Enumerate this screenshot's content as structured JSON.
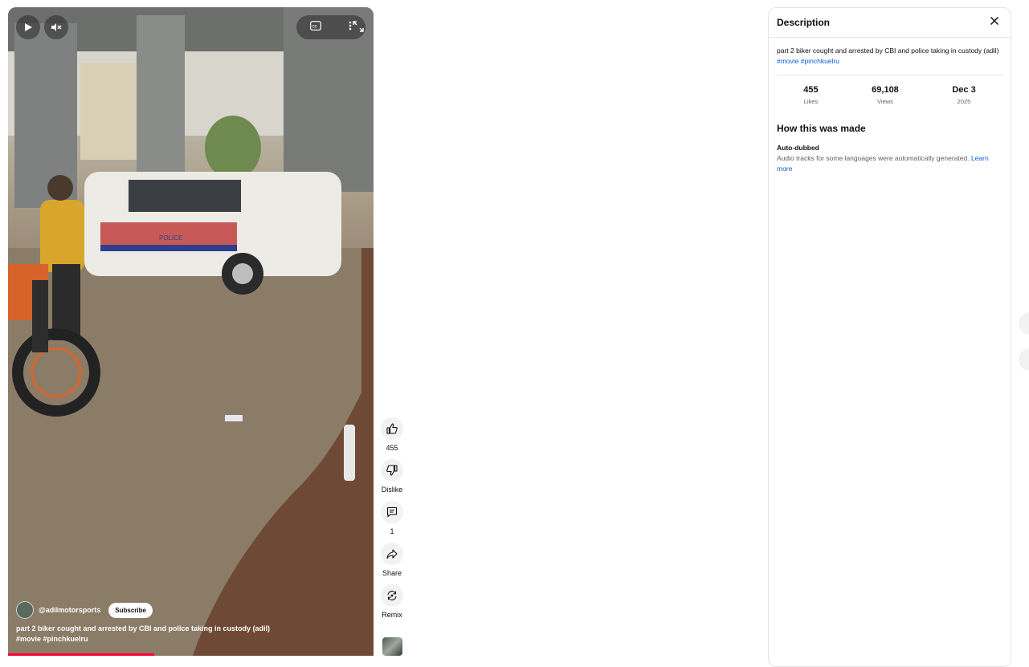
{
  "player": {
    "overlay": {
      "channel": "@adilmotorsports",
      "subscribe_label": "Subscribe",
      "title": "part 2 biker cought and arrested by CBI and police taking in custody (adil)",
      "tags": "#movie #pinchkuelru"
    },
    "controls": [
      "play-icon",
      "mute-icon",
      "captions-icon",
      "more-icon",
      "fullscreen-icon"
    ],
    "scene_sign_text": "POLICE",
    "progress_fraction": 0.4
  },
  "actions": {
    "like_count": "455",
    "dislike_label": "Dislike",
    "comment_count": "1",
    "share_label": "Share",
    "remix_label": "Remix"
  },
  "description": {
    "title": "Description",
    "text": "part 2 biker cought and arrested by CBI and police taking in custody (adil)",
    "tag1": "#movie",
    "tag2": "#pinchkuelru",
    "stats": [
      {
        "value": "455",
        "label": "Likes"
      },
      {
        "value": "69,108",
        "label": "Views"
      },
      {
        "value": "Dec 3",
        "label": "2025"
      }
    ],
    "how_title": "How this was made",
    "how_sub": "Auto-dubbed",
    "how_text": "Audio tracks for some languages were automatically generated.",
    "learn_more": "Learn more"
  },
  "colors": {
    "accent_link": "#065fd4",
    "progress": "#ff0033"
  }
}
